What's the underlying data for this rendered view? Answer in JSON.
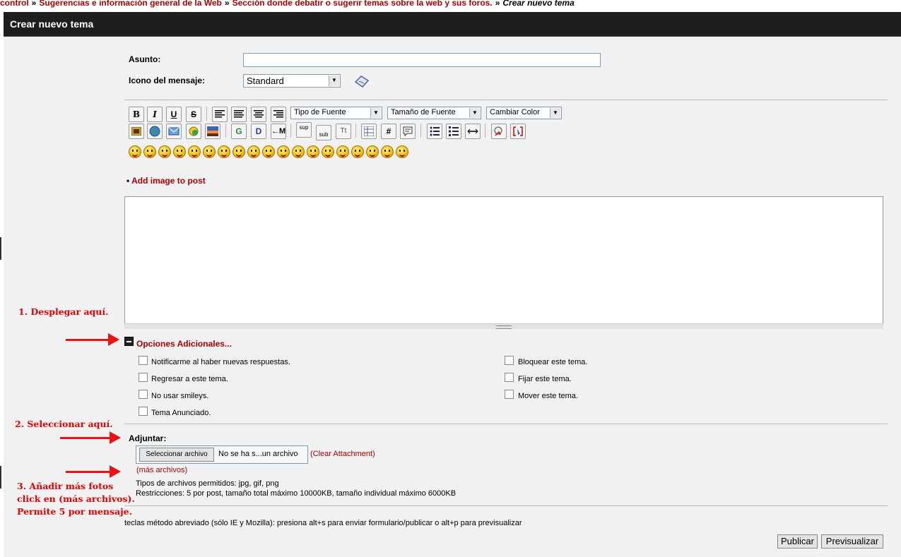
{
  "breadcrumb": {
    "items": [
      "control",
      "Sugerencias e información general de la Web",
      "Sección donde debatir o sugerir temas sobre la web y sus foros."
    ],
    "separator": "»",
    "current": "Crear nuevo tema"
  },
  "header": {
    "title": "Crear nuevo tema"
  },
  "form": {
    "subject_label": "Asunto:",
    "subject_value": "",
    "icon_label": "Icono del mensaje:",
    "icon_value": "Standard"
  },
  "toolbar": {
    "font_type": "Tipo de Fuente",
    "font_size": "Tamaño de Fuente",
    "font_color": "Cambiar Color",
    "buttons_row1": [
      "B",
      "I",
      "U",
      "S"
    ],
    "buttons_row2": [
      "G",
      "D",
      "M",
      "sup",
      "sub",
      "Tt",
      "#"
    ]
  },
  "add_image_link": "Add image to post",
  "body_value": "",
  "options": {
    "title": "Opciones Adicionales...",
    "left": [
      "Notificarme al haber nuevas respuestas.",
      "Regresar a este tema.",
      "No usar smileys.",
      "Tema Anunciado."
    ],
    "right": [
      "Bloquear este tema.",
      "Fijar este tema.",
      "Mover este tema."
    ]
  },
  "attach": {
    "label": "Adjuntar:",
    "file_button": "Seleccionar archivo",
    "file_status": "No se ha s...un archivo",
    "clear_open": "(",
    "clear_link": "Clear Attachment",
    "clear_close": ")",
    "more_files": "(más archivos)",
    "allowed": "Tipos de archivos permitidos: jpg, gif, png",
    "restrictions": "Restricciones: 5 por post, tamaño total máximo 10000KB, tamaño individual máximo 6000KB"
  },
  "shortcuts": "teclas método abreviado (sólo IE y Mozilla): presiona alt+s para enviar formulario/publicar o alt+p para previsualizar",
  "buttons": {
    "publish": "Publicar",
    "preview": "Previsualizar"
  },
  "annotations": {
    "a1": "1. Desplegar aquí.",
    "a2": "2. Seleccionar aquí.",
    "a3_line1": "3. Añadir más fotos",
    "a3_line2": "click en (más archivos).",
    "a3_line3": "Permite 5 por mensaje."
  },
  "colors": {
    "link": "#aa0000",
    "annotation": "#e80000",
    "header_bg": "#1e1e1e",
    "panel_bg": "#f1f1f1"
  }
}
